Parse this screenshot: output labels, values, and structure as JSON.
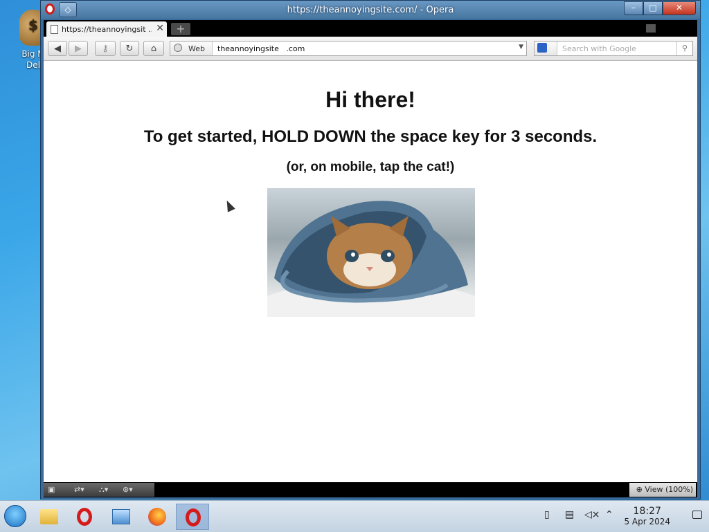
{
  "desktop": {
    "icon_label": "Big M\nDel",
    "icon_glyph": "$"
  },
  "window": {
    "title": "https://theannoyingsite.com/ - Opera",
    "min_glyph": "–",
    "max_glyph": "□",
    "close_glyph": "✕"
  },
  "tab": {
    "label": "https://theannoyingsit ...",
    "close_glyph": "✕",
    "new_glyph": "+"
  },
  "toolbar": {
    "back_glyph": "◀",
    "forward_glyph": "▶",
    "key_glyph": "⚷",
    "reload_glyph": "↻",
    "home_glyph": "⌂",
    "web_label": "Web",
    "address": "theannoyingsite   .com",
    "search_placeholder": "Search  with Google"
  },
  "page": {
    "heading": "Hi there!",
    "instruction": "To get started, HOLD DOWN the space key for 3 seconds.",
    "mobile_note": "(or, on mobile, tap the cat!)"
  },
  "statusbar": {
    "zoom_label": "View (100%)"
  },
  "taskbar": {
    "time": "18:27",
    "date": "5 Apr 2024"
  }
}
